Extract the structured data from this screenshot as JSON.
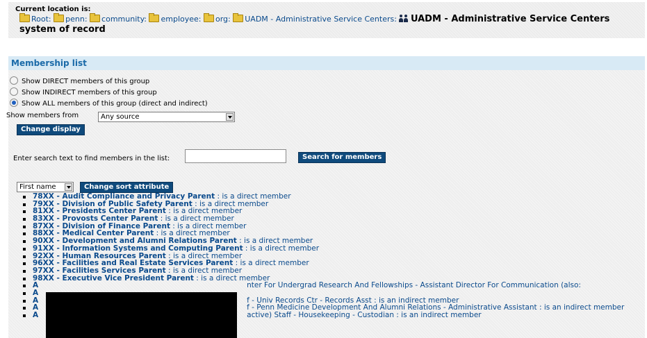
{
  "location": {
    "label": "Current location is:",
    "crumbs": [
      "Root:",
      "penn:",
      "community:",
      "employee:",
      "org:",
      "UADM - Administrative Service Centers:"
    ],
    "current": "UADM - Administrative Service Centers system of record"
  },
  "panel": {
    "title": "Membership list",
    "radio_direct": "Show DIRECT members of this group",
    "radio_indirect": "Show INDIRECT members of this group",
    "radio_all": "Show ALL members of this group (direct and indirect)",
    "selected_radio": "all",
    "show_from_label": "Show members from",
    "source_select": "Any source",
    "change_display": "Change display",
    "search_label": "Enter search text to find members in the list:",
    "search_value": "",
    "search_button": "Search for members",
    "sort_select": "First name",
    "sort_button": "Change sort attribute"
  },
  "members": [
    {
      "name": "78XX - Audit Compliance and Privacy Parent",
      "status": " : is a direct member"
    },
    {
      "name": "79XX - Division of Public Safety Parent",
      "status": " : is a direct member"
    },
    {
      "name": "81XX - Presidents Center Parent",
      "status": " : is a direct member"
    },
    {
      "name": "83XX - Provosts Center Parent",
      "status": " : is a direct member"
    },
    {
      "name": "87XX - Division of Finance Parent",
      "status": " : is a direct member"
    },
    {
      "name": "88XX - Medical Center Parent",
      "status": " : is a direct member"
    },
    {
      "name": "90XX - Development and Alumni Relations Parent",
      "status": " : is a direct member"
    },
    {
      "name": "91XX - Information Systems and Computing Parent",
      "status": " : is a direct member"
    },
    {
      "name": "92XX - Human Resources Parent",
      "status": " : is a direct member"
    },
    {
      "name": "96XX - Facilities and Real Estate Services Parent",
      "status": " : is a direct member"
    },
    {
      "name": "97XX - Facilities Services Parent",
      "status": " : is a direct member"
    },
    {
      "name": "98XX - Executive Vice President Parent",
      "status": " : is a direct member"
    },
    {
      "name": "A",
      "status": "nter For Undergrad Research And Fellowships - Assistant Director For Communication (also:"
    },
    {
      "name": "A",
      "status": ""
    },
    {
      "name": "A",
      "status": "f - Univ Records Ctr - Records Asst : is an indirect member"
    },
    {
      "name": "A",
      "status": "f - Penn Medicine Development And Alumni Relations - Administrative Assistant : is an indirect member"
    },
    {
      "name": "A",
      "status": "active) Staff - Housekeeping - Custodian : is an indirect member"
    }
  ]
}
